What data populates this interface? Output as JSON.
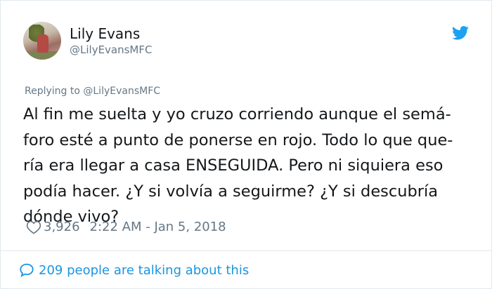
{
  "user": {
    "display_name": "Lily Evans",
    "handle": "@LilyEvansMFC"
  },
  "tweet": {
    "replying_to": "Replying to @LilyEvansMFC",
    "lines": [
      "Al fin me suelta y yo cruzo corriendo aunque el semá-",
      "foro esté a punto de ponerse en rojo. Todo lo que que-",
      "ría era llegar a casa ENSEGUIDA. Pero ni siquiera eso",
      "podía hacer. ¿Y si volvía a seguirme? ¿Y si descubría",
      "dónde vivo?"
    ],
    "likes": "3,926",
    "timestamp": "2:22 AM - Jan 5, 2018"
  },
  "footer": {
    "talking": "209 people are talking about this"
  },
  "icons": {
    "brand": "twitter-bird-icon",
    "like": "heart-icon",
    "reply": "speech-bubble-icon"
  },
  "colors": {
    "accent": "#1da1f2",
    "link": "#1b95e0",
    "muted": "#657786",
    "text": "#14171a",
    "border": "#e1e8ed"
  }
}
